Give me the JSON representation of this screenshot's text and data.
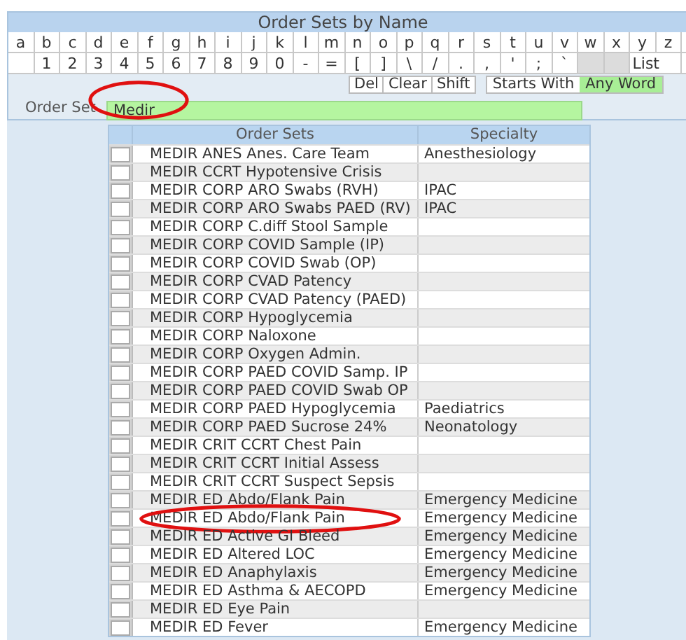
{
  "title": "Order Sets by Name",
  "letter_keys": [
    "a",
    "b",
    "c",
    "d",
    "e",
    "f",
    "g",
    "h",
    "i",
    "j",
    "k",
    "l",
    "m",
    "n",
    "o",
    "p",
    "q",
    "r",
    "s",
    "t",
    "u",
    "v",
    "w",
    "x",
    "y",
    "z"
  ],
  "symbol_keys": [
    {
      "kind": "blank"
    },
    {
      "kind": "key",
      "label": "1"
    },
    {
      "kind": "key",
      "label": "2"
    },
    {
      "kind": "key",
      "label": "3"
    },
    {
      "kind": "key",
      "label": "4"
    },
    {
      "kind": "key",
      "label": "5"
    },
    {
      "kind": "key",
      "label": "6"
    },
    {
      "kind": "key",
      "label": "7"
    },
    {
      "kind": "key",
      "label": "8"
    },
    {
      "kind": "key",
      "label": "9"
    },
    {
      "kind": "key",
      "label": "0"
    },
    {
      "kind": "key",
      "label": "-"
    },
    {
      "kind": "key",
      "label": "="
    },
    {
      "kind": "key",
      "label": "["
    },
    {
      "kind": "key",
      "label": "]"
    },
    {
      "kind": "key",
      "label": "\\"
    },
    {
      "kind": "key",
      "label": "/"
    },
    {
      "kind": "key",
      "label": "."
    },
    {
      "kind": "key",
      "label": ","
    },
    {
      "kind": "key",
      "label": "'"
    },
    {
      "kind": "key",
      "label": ";"
    },
    {
      "kind": "key",
      "label": "`"
    },
    {
      "kind": "disabled"
    },
    {
      "kind": "disabled"
    },
    {
      "kind": "wide",
      "label": "List"
    }
  ],
  "edit_buttons": [
    "Del",
    "Clear",
    "Shift"
  ],
  "match_modes": [
    {
      "label": "Starts With",
      "selected": false
    },
    {
      "label": "Any Word",
      "selected": true
    }
  ],
  "search": {
    "label": "Order Set",
    "value": "Medir",
    "highlighted": true
  },
  "table": {
    "columns": [
      "Order Sets",
      "Specialty"
    ],
    "rows": [
      {
        "order_set": "MEDIR ANES Anes. Care Team",
        "specialty": "Anesthesiology",
        "checked": false,
        "highlighted": false
      },
      {
        "order_set": "MEDIR CCRT Hypotensive Crisis",
        "checked": false,
        "highlighted": false
      },
      {
        "order_set": "MEDIR CORP ARO Swabs (RVH)",
        "specialty": "IPAC",
        "checked": false,
        "highlighted": false
      },
      {
        "order_set": "MEDIR CORP ARO Swabs PAED (RV)",
        "specialty": "IPAC",
        "checked": false,
        "highlighted": false
      },
      {
        "order_set": "MEDIR CORP C.diff Stool Sample",
        "checked": false,
        "highlighted": false
      },
      {
        "order_set": "MEDIR CORP COVID Sample (IP)",
        "checked": false,
        "highlighted": false
      },
      {
        "order_set": "MEDIR CORP COVID Swab (OP)",
        "checked": false,
        "highlighted": false
      },
      {
        "order_set": "MEDIR CORP CVAD Patency",
        "checked": false,
        "highlighted": false
      },
      {
        "order_set": "MEDIR CORP CVAD Patency (PAED)",
        "checked": false,
        "highlighted": false
      },
      {
        "order_set": "MEDIR CORP Hypoglycemia",
        "checked": false,
        "highlighted": false
      },
      {
        "order_set": "MEDIR CORP Naloxone",
        "checked": false,
        "highlighted": false
      },
      {
        "order_set": "MEDIR CORP Oxygen Admin.",
        "checked": false,
        "highlighted": false
      },
      {
        "order_set": "MEDIR CORP PAED COVID Samp. IP",
        "checked": false,
        "highlighted": false
      },
      {
        "order_set": "MEDIR CORP PAED COVID Swab OP",
        "checked": false,
        "highlighted": false
      },
      {
        "order_set": "MEDIR CORP PAED Hypoglycemia",
        "specialty": "Paediatrics",
        "checked": false,
        "highlighted": false
      },
      {
        "order_set": "MEDIR CORP PAED Sucrose 24%",
        "specialty": "Neonatology",
        "checked": false,
        "highlighted": false
      },
      {
        "order_set": "MEDIR CRIT CCRT Chest Pain",
        "checked": false,
        "highlighted": false
      },
      {
        "order_set": "MEDIR CRIT CCRT Initial Assess",
        "checked": false,
        "highlighted": false
      },
      {
        "order_set": "MEDIR CRIT CCRT Suspect Sepsis",
        "checked": false,
        "highlighted": false
      },
      {
        "order_set": "MEDIR ED Abdo/Flank Pain",
        "specialty": "Emergency Medicine",
        "checked": false,
        "highlighted": false
      },
      {
        "order_set": "MEDIR ED Abdo/Flank Pain",
        "specialty": "Emergency Medicine",
        "checked": false,
        "highlighted": true
      },
      {
        "order_set": "MEDIR ED Active GI Bleed",
        "specialty": "Emergency Medicine",
        "checked": false,
        "highlighted": false
      },
      {
        "order_set": "MEDIR ED Altered LOC",
        "specialty": "Emergency Medicine",
        "checked": false,
        "highlighted": false
      },
      {
        "order_set": "MEDIR ED Anaphylaxis",
        "specialty": "Emergency Medicine",
        "checked": false,
        "highlighted": false
      },
      {
        "order_set": "MEDIR ED Asthma & AECOPD",
        "specialty": "Emergency Medicine",
        "checked": false,
        "highlighted": false
      },
      {
        "order_set": "MEDIR ED Eye Pain",
        "checked": false,
        "highlighted": false
      },
      {
        "order_set": "MEDIR ED Fever",
        "specialty": "Emergency Medicine",
        "checked": false,
        "highlighted": false
      }
    ]
  }
}
